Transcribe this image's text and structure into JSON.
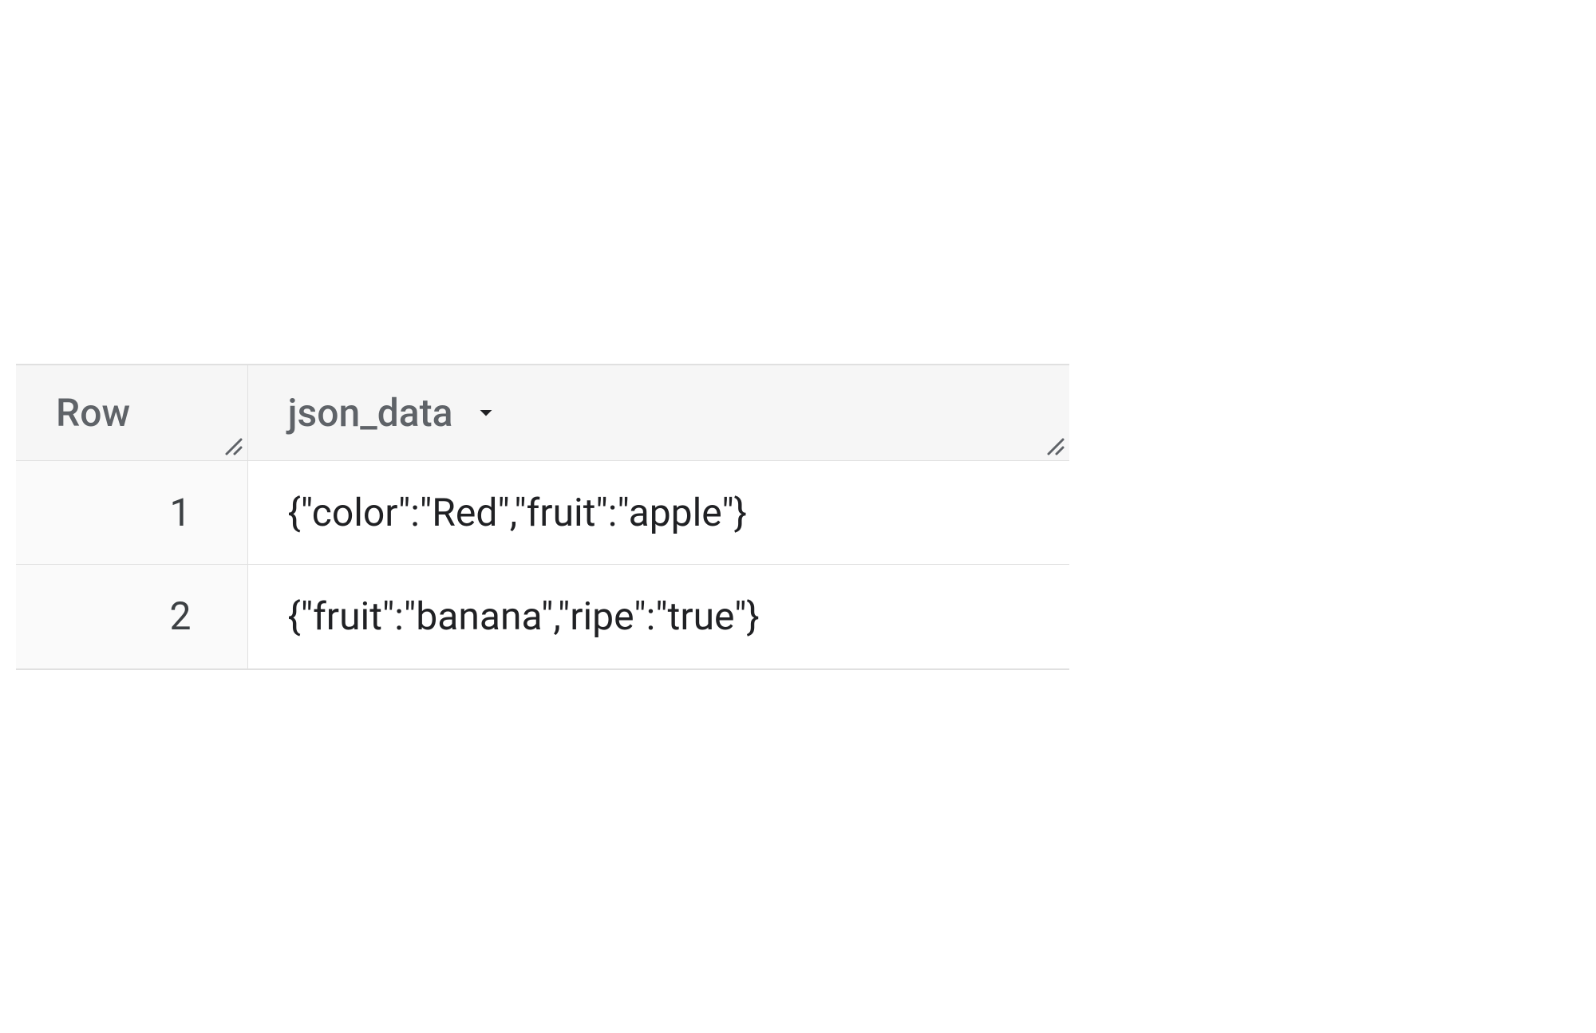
{
  "table": {
    "columns": {
      "row": "Row",
      "json_data": "json_data"
    },
    "rows": [
      {
        "index": "1",
        "json_data": "{\"color\":\"Red\",\"fruit\":\"apple\"}"
      },
      {
        "index": "2",
        "json_data": "{\"fruit\":\"banana\",\"ripe\":\"true\"}"
      }
    ]
  }
}
